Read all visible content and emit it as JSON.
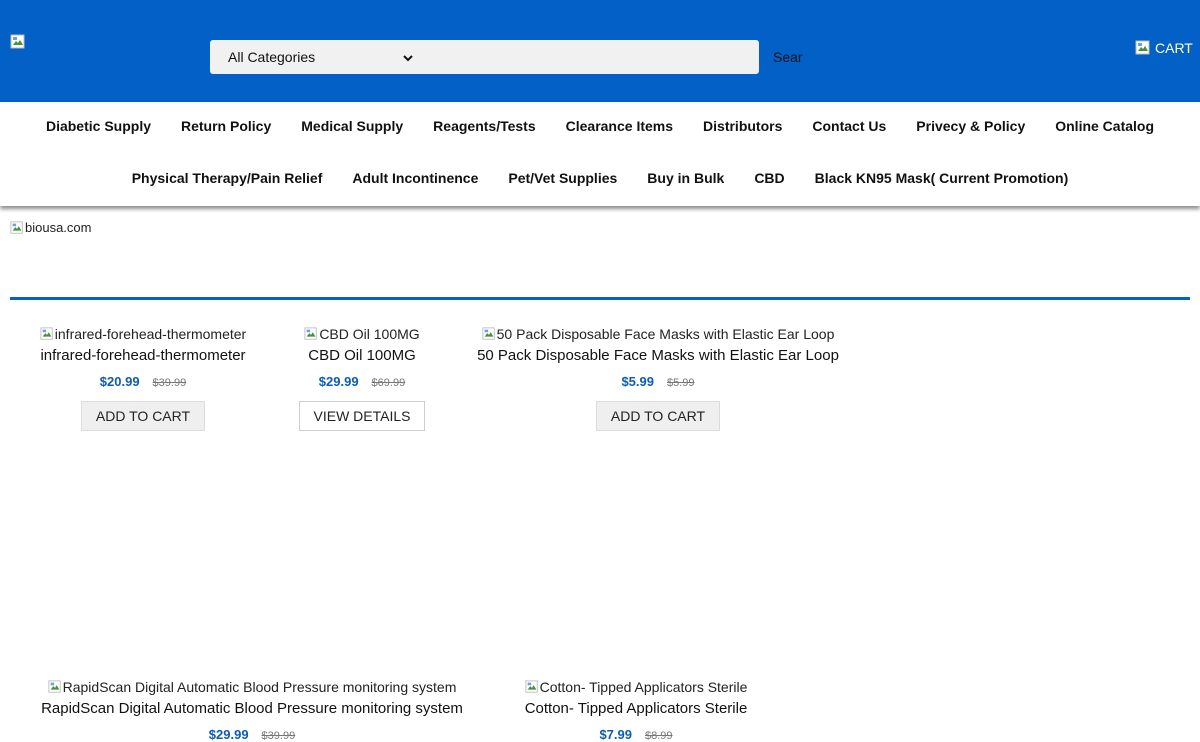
{
  "header": {
    "category_selected": "All Categories",
    "search_button": "Sear",
    "cart_label": "CART"
  },
  "nav": {
    "row1": [
      "Diabetic Supply",
      "Return Policy",
      "Medical Supply",
      "Reagents/Tests",
      "Clearance Items",
      "Distributors",
      "Contact Us",
      "Privecy & Policy",
      "Online Catalog"
    ],
    "row2": [
      "Physical Therapy/Pain Relief",
      "Adult Incontinence",
      "Pet/Vet Supplies",
      "Buy in Bulk",
      "CBD",
      "Black KN95 Mask( Current Promotion)"
    ]
  },
  "banner": {
    "alt": "biousa.com"
  },
  "products": [
    {
      "img_alt": "infrared-forehead-thermometer",
      "name": "infrared-forehead-thermometer",
      "price": "$20.99",
      "old_price": "$39.99",
      "button": "ADD TO CART"
    },
    {
      "img_alt": "CBD Oil 100MG",
      "name": "CBD Oil 100MG",
      "price": "$29.99",
      "old_price": "$69.99",
      "button": "VIEW DETAILS"
    },
    {
      "img_alt": "50 Pack Disposable Face Masks with Elastic Ear Loop",
      "name": "50 Pack Disposable Face Masks with Elastic Ear Loop",
      "price": "$5.99",
      "old_price": "$5.99",
      "button": "ADD TO CART"
    },
    {
      "img_alt": "RapidScan Digital Automatic Blood Pressure monitoring system",
      "name": "RapidScan Digital Automatic Blood Pressure monitoring system",
      "price": "$29.99",
      "old_price": "$39.99"
    },
    {
      "img_alt": "Cotton- Tipped Applicators Sterile",
      "name": "Cotton- Tipped Applicators Sterile",
      "price": "$7.99",
      "old_price": "$8.99"
    }
  ],
  "colors": {
    "brand_blue": "#0260c6",
    "price_blue": "#0d5cb6"
  },
  "icons": [
    "broken-image-icon",
    "chevron-down-icon",
    "cart-icon"
  ]
}
